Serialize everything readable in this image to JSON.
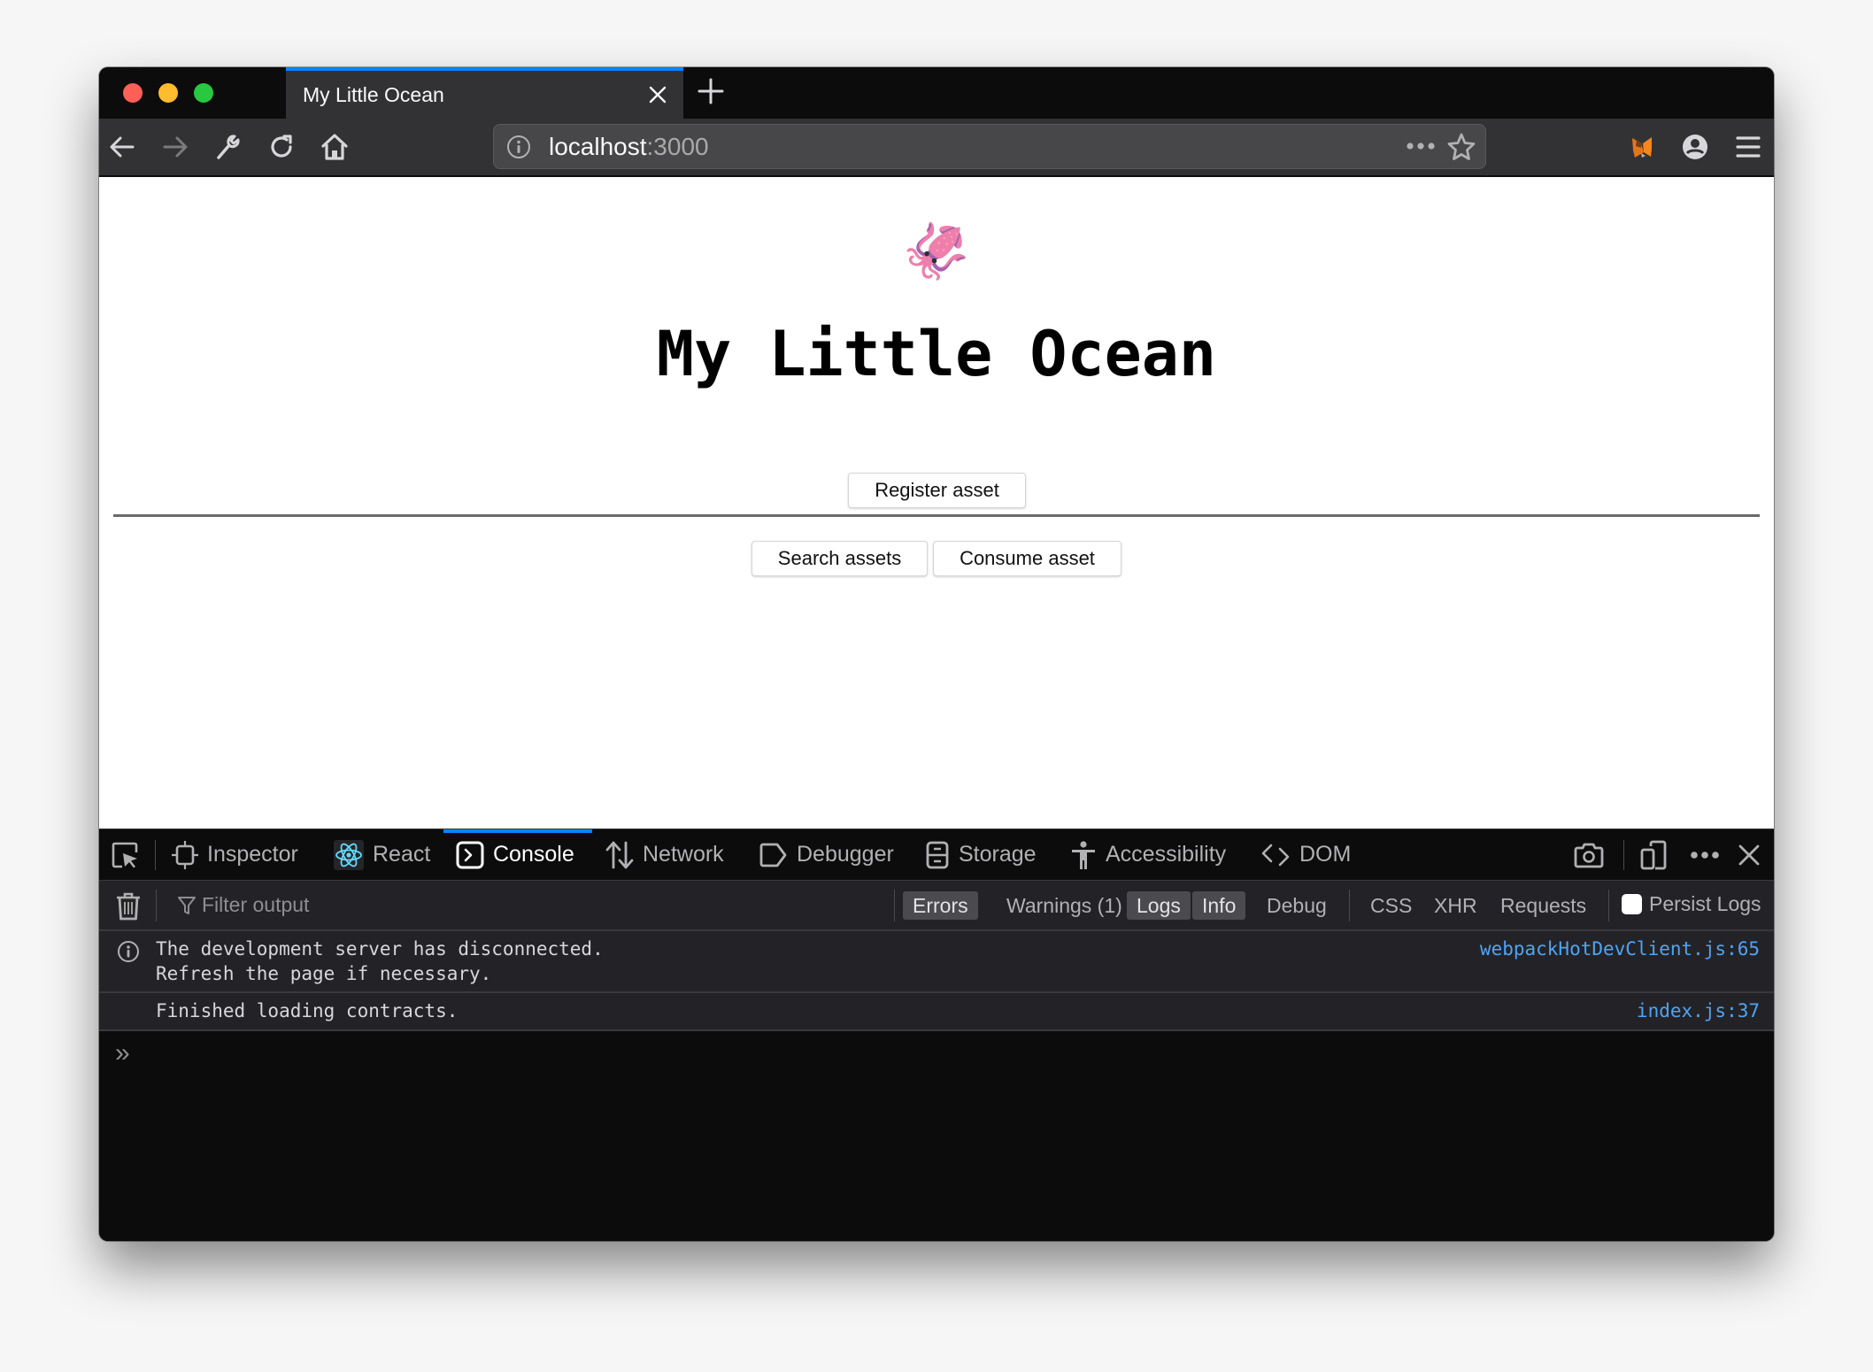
{
  "browser": {
    "tab_title": "My Little Ocean",
    "url_host": "localhost",
    "url_port": ":3000"
  },
  "page": {
    "logo_emoji": "🦑",
    "title": "My Little Ocean",
    "buttons": {
      "register": "Register asset",
      "search": "Search assets",
      "consume": "Consume asset"
    }
  },
  "devtools": {
    "tabs": [
      {
        "label": "Inspector",
        "icon": "inspector-icon"
      },
      {
        "label": "React",
        "icon": "react-icon"
      },
      {
        "label": "Console",
        "icon": "console-icon",
        "active": true
      },
      {
        "label": "Network",
        "icon": "network-icon"
      },
      {
        "label": "Debugger",
        "icon": "debugger-icon"
      },
      {
        "label": "Storage",
        "icon": "storage-icon"
      },
      {
        "label": "Accessibility",
        "icon": "accessibility-icon"
      },
      {
        "label": "DOM",
        "icon": "dom-icon"
      }
    ],
    "filter_placeholder": "Filter output",
    "levels": [
      {
        "label": "Errors",
        "on": true
      },
      {
        "label": "Warnings (1)",
        "on": false
      },
      {
        "label": "Logs",
        "on": true
      },
      {
        "label": "Info",
        "on": true
      },
      {
        "label": "Debug",
        "on": false
      }
    ],
    "categories": [
      "CSS",
      "XHR",
      "Requests"
    ],
    "persist_logs_label": "Persist Logs",
    "persist_logs_checked": false,
    "messages": [
      {
        "text": "The development server has disconnected.\nRefresh the page if necessary.",
        "source": "webpackHotDevClient.js:65",
        "type": "info"
      },
      {
        "text": "Finished loading contracts.",
        "source": "index.js:37",
        "type": "log"
      }
    ],
    "prompt_symbol": "»"
  },
  "colors": {
    "accent": "#0a84ff",
    "link": "#4fa4f4",
    "traffic_red": "#fe5f57",
    "traffic_yellow": "#febc2e",
    "traffic_green": "#28c840"
  }
}
